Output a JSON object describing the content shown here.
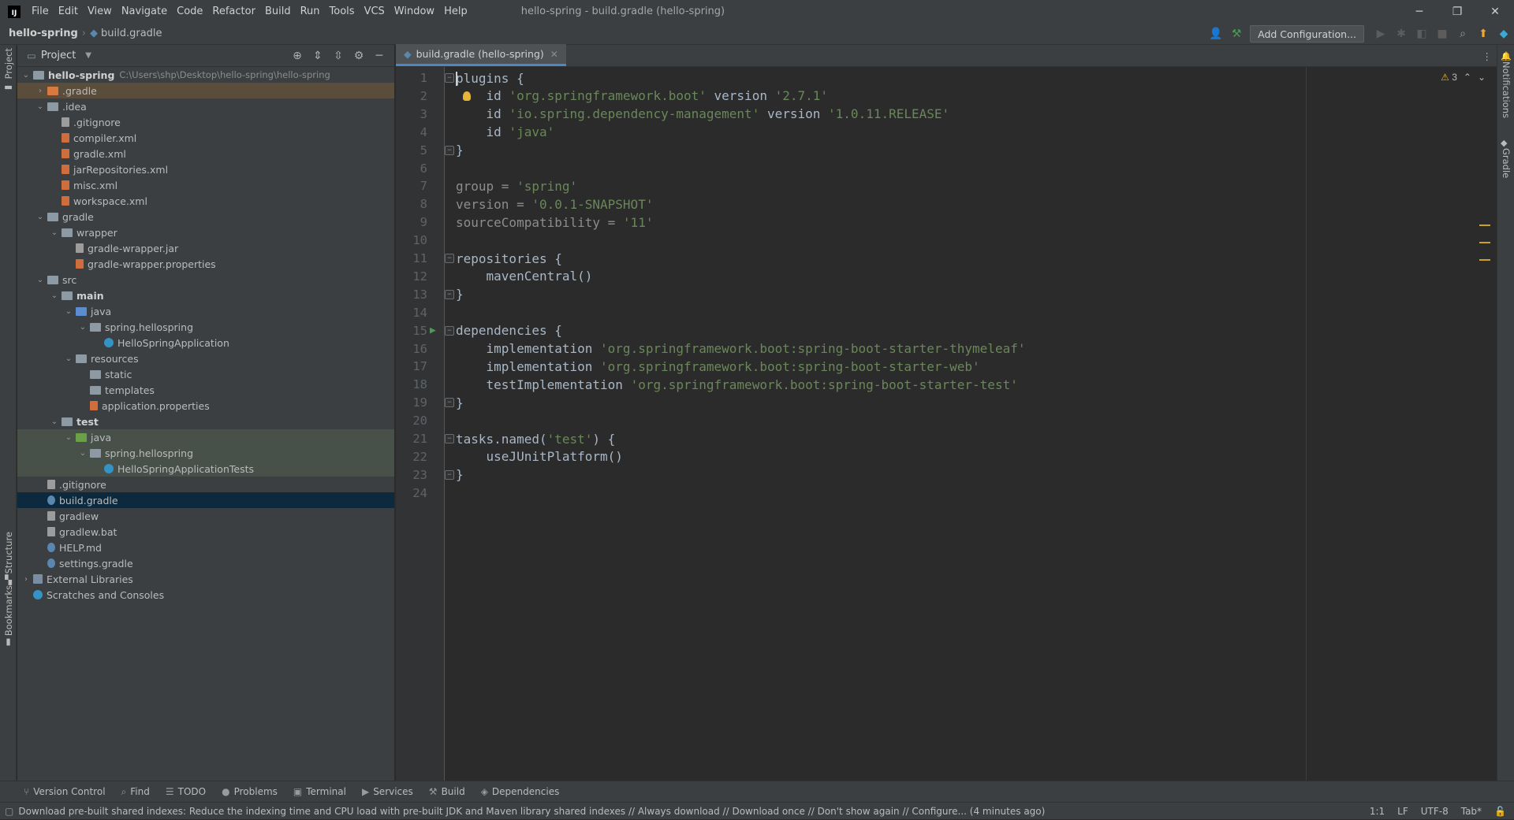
{
  "app": {
    "logo_text": "IJ",
    "window_title": "hello-spring - build.gradle (hello-spring)"
  },
  "menu": [
    "File",
    "Edit",
    "View",
    "Navigate",
    "Code",
    "Refactor",
    "Build",
    "Run",
    "Tools",
    "VCS",
    "Window",
    "Help"
  ],
  "breadcrumb": {
    "project": "hello-spring",
    "file": "build.gradle"
  },
  "toolbar": {
    "add_config": "Add Configuration..."
  },
  "project_panel": {
    "title": "Project",
    "root_label": "hello-spring",
    "root_path": "C:\\Users\\shp\\Desktop\\hello-spring\\hello-spring"
  },
  "tree": [
    {
      "label": ".gradle",
      "depth": 1,
      "arrow": "right",
      "icon": "folder-or",
      "style": "gradle"
    },
    {
      "label": ".idea",
      "depth": 1,
      "arrow": "down",
      "icon": "folder"
    },
    {
      "label": ".gitignore",
      "depth": 2,
      "icon": "filegen"
    },
    {
      "label": "compiler.xml",
      "depth": 2,
      "icon": "filexml"
    },
    {
      "label": "gradle.xml",
      "depth": 2,
      "icon": "filexml"
    },
    {
      "label": "jarRepositories.xml",
      "depth": 2,
      "icon": "filexml"
    },
    {
      "label": "misc.xml",
      "depth": 2,
      "icon": "filexml"
    },
    {
      "label": "workspace.xml",
      "depth": 2,
      "icon": "filexml"
    },
    {
      "label": "gradle",
      "depth": 1,
      "arrow": "down",
      "icon": "folder"
    },
    {
      "label": "wrapper",
      "depth": 2,
      "arrow": "down",
      "icon": "folder"
    },
    {
      "label": "gradle-wrapper.jar",
      "depth": 3,
      "icon": "filegen"
    },
    {
      "label": "gradle-wrapper.properties",
      "depth": 3,
      "icon": "filexml"
    },
    {
      "label": "src",
      "depth": 1,
      "arrow": "down",
      "icon": "folder"
    },
    {
      "label": "main",
      "depth": 2,
      "arrow": "down",
      "icon": "folder",
      "bold": true
    },
    {
      "label": "java",
      "depth": 3,
      "arrow": "down",
      "icon": "folder-bl"
    },
    {
      "label": "spring.hellospring",
      "depth": 4,
      "arrow": "down",
      "icon": "folder"
    },
    {
      "label": "HelloSpringApplication",
      "depth": 5,
      "icon": "javacls"
    },
    {
      "label": "resources",
      "depth": 3,
      "arrow": "down",
      "icon": "folder"
    },
    {
      "label": "static",
      "depth": 4,
      "icon": "folder"
    },
    {
      "label": "templates",
      "depth": 4,
      "icon": "folder"
    },
    {
      "label": "application.properties",
      "depth": 4,
      "icon": "filexml"
    },
    {
      "label": "test",
      "depth": 2,
      "arrow": "down",
      "icon": "folder",
      "bold": true
    },
    {
      "label": "java",
      "depth": 3,
      "arrow": "down",
      "icon": "folder-gr",
      "style": "hl"
    },
    {
      "label": "spring.hellospring",
      "depth": 4,
      "arrow": "down",
      "icon": "folder",
      "style": "hl"
    },
    {
      "label": "HelloSpringApplicationTests",
      "depth": 5,
      "icon": "javacls",
      "style": "hl"
    },
    {
      "label": ".gitignore",
      "depth": 1,
      "icon": "filegen"
    },
    {
      "label": "build.gradle",
      "depth": 1,
      "icon": "fileg",
      "style": "sel"
    },
    {
      "label": "gradlew",
      "depth": 1,
      "icon": "filegen"
    },
    {
      "label": "gradlew.bat",
      "depth": 1,
      "icon": "filegen"
    },
    {
      "label": "HELP.md",
      "depth": 1,
      "icon": "fileg"
    },
    {
      "label": "settings.gradle",
      "depth": 1,
      "icon": "fileg"
    },
    {
      "label": "External Libraries",
      "depth": 0,
      "arrow": "right",
      "icon": "lib"
    },
    {
      "label": "Scratches and Consoles",
      "depth": 0,
      "icon": "javacls"
    }
  ],
  "editor": {
    "tab_label": "build.gradle (hello-spring)",
    "warnings": "3",
    "lines": [
      [
        [
          "plain",
          "plugins {"
        ]
      ],
      [
        [
          "plain",
          "    id "
        ],
        [
          "str",
          "'org.springframework.boot'"
        ],
        [
          "plain",
          " version "
        ],
        [
          "str",
          "'2.7.1'"
        ]
      ],
      [
        [
          "plain",
          "    id "
        ],
        [
          "str",
          "'io.spring.dependency-management'"
        ],
        [
          "plain",
          " version "
        ],
        [
          "str",
          "'1.0.11.RELEASE'"
        ]
      ],
      [
        [
          "plain",
          "    id "
        ],
        [
          "str",
          "'java'"
        ]
      ],
      [
        [
          "plain",
          "}"
        ]
      ],
      [],
      [
        [
          "grey",
          "group = "
        ],
        [
          "str",
          "'spring'"
        ]
      ],
      [
        [
          "grey",
          "version = "
        ],
        [
          "str",
          "'0.0.1-SNAPSHOT'"
        ]
      ],
      [
        [
          "grey",
          "sourceCompatibility = "
        ],
        [
          "str",
          "'11'"
        ]
      ],
      [],
      [
        [
          "plain",
          "repositories {"
        ]
      ],
      [
        [
          "plain",
          "    mavenCentral()"
        ]
      ],
      [
        [
          "plain",
          "}"
        ]
      ],
      [],
      [
        [
          "plain",
          "dependencies {"
        ]
      ],
      [
        [
          "plain",
          "    implementation "
        ],
        [
          "str",
          "'org.springframework.boot:spring-boot-starter-thymeleaf'"
        ]
      ],
      [
        [
          "plain",
          "    implementation "
        ],
        [
          "str",
          "'org.springframework.boot:spring-boot-starter-web'"
        ]
      ],
      [
        [
          "plain",
          "    testImplementation "
        ],
        [
          "str",
          "'org.springframework.boot:spring-boot-starter-test'"
        ]
      ],
      [
        [
          "plain",
          "}"
        ]
      ],
      [],
      [
        [
          "plain",
          "tasks.named("
        ],
        [
          "str",
          "'test'"
        ],
        [
          "plain",
          ") {"
        ]
      ],
      [
        [
          "plain",
          "    useJUnitPlatform()"
        ]
      ],
      [
        [
          "plain",
          "}"
        ]
      ],
      []
    ]
  },
  "side_tabs": {
    "project": "Project",
    "structure": "Structure",
    "bookmarks": "Bookmarks",
    "notifications": "Notifications",
    "gradle": "Gradle"
  },
  "bottom_tools": [
    "Version Control",
    "Find",
    "TODO",
    "Problems",
    "Terminal",
    "Services",
    "Build",
    "Dependencies"
  ],
  "status": {
    "message": "Download pre-built shared indexes: Reduce the indexing time and CPU load with pre-built JDK and Maven library shared indexes // Always download // Download once // Don't show again // Configure... (4 minutes ago)",
    "position": "1:1",
    "line_sep": "LF",
    "encoding": "UTF-8",
    "indent": "Tab*"
  }
}
